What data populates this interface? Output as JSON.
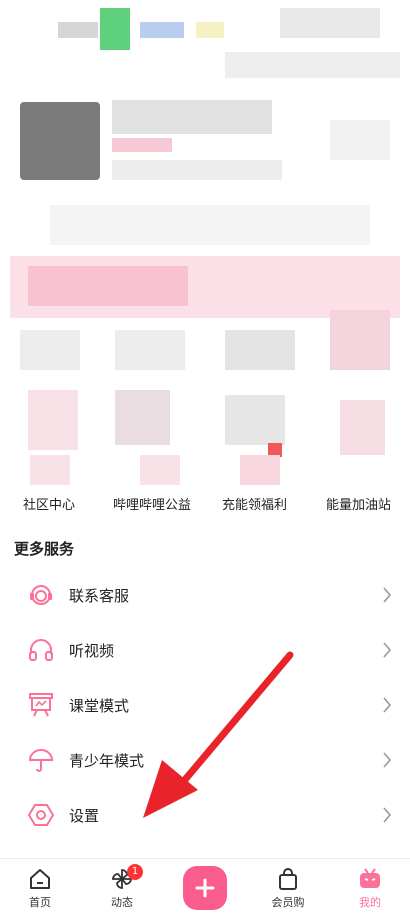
{
  "quick_links": [
    {
      "label": "社区中心"
    },
    {
      "label": "哔哩哔哩公益"
    },
    {
      "label": "充能领福利"
    },
    {
      "label": "能量加油站"
    }
  ],
  "more_services": {
    "title": "更多服务",
    "items": [
      {
        "label": "联系客服",
        "icon": "headset-icon"
      },
      {
        "label": "听视频",
        "icon": "headphones-icon"
      },
      {
        "label": "课堂模式",
        "icon": "classroom-board-icon"
      },
      {
        "label": "青少年模式",
        "icon": "umbrella-icon"
      },
      {
        "label": "设置",
        "icon": "gear-icon"
      }
    ]
  },
  "bottom_nav": {
    "tabs": [
      {
        "label": "首页",
        "icon": "home-icon"
      },
      {
        "label": "动态",
        "icon": "pinwheel-icon",
        "badge": "1"
      },
      {
        "label": "",
        "icon": "plus-icon"
      },
      {
        "label": "会员购",
        "icon": "shopping-bag-icon"
      },
      {
        "label": "我的",
        "icon": "tv-mascot-icon",
        "active": true
      }
    ]
  },
  "colors": {
    "accent": "#fb7299",
    "plus": "#fb5c8e",
    "arrow": "#e8242a",
    "badge": "#ff3333"
  }
}
